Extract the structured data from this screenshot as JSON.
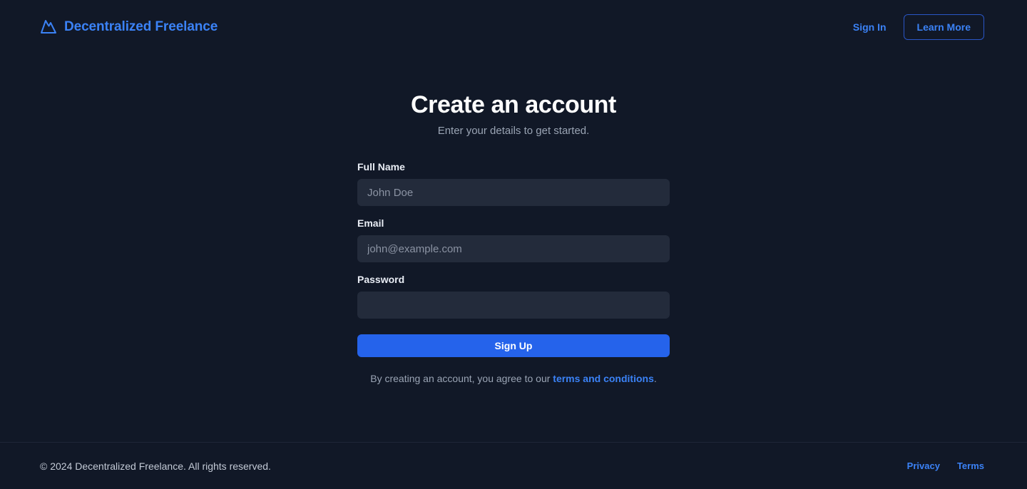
{
  "header": {
    "brand_icon": "mountain-icon",
    "brand_name": "Decentralized Freelance",
    "sign_in_label": "Sign In",
    "learn_more_label": "Learn More"
  },
  "main": {
    "title": "Create an account",
    "subtitle": "Enter your details to get started.",
    "fields": [
      {
        "label": "Full Name",
        "value": "",
        "placeholder": "John Doe"
      },
      {
        "label": "Email",
        "value": "",
        "placeholder": "john@example.com"
      },
      {
        "label": "Password",
        "value": "",
        "placeholder": ""
      }
    ],
    "submit_label": "Sign Up",
    "terms_prefix": "By creating an account, you agree to our ",
    "terms_link": "terms and conditions",
    "terms_suffix": "."
  },
  "footer": {
    "copyright": "© 2024 Decentralized Freelance. All rights reserved.",
    "links": [
      {
        "label": "Privacy"
      },
      {
        "label": "Terms"
      }
    ]
  },
  "colors": {
    "background": "#111827",
    "accent": "#3b82f6",
    "button": "#2563eb",
    "input_background": "#232b3b",
    "muted_text": "#9aa4b4"
  }
}
